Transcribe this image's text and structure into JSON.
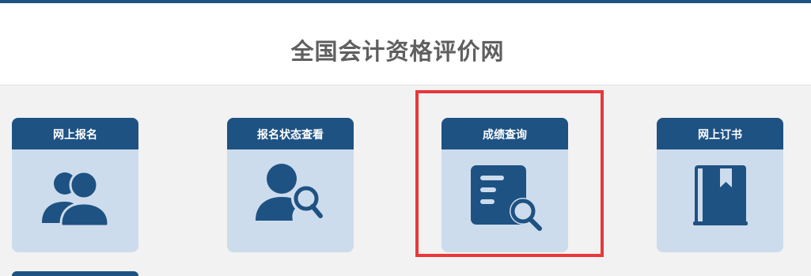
{
  "header": {
    "title": "全国会计资格评价网"
  },
  "cards": [
    {
      "label": "网上报名",
      "icon": "users-icon"
    },
    {
      "label": "报名状态查看",
      "icon": "user-search-icon"
    },
    {
      "label": "成绩查询",
      "icon": "document-search-icon"
    },
    {
      "label": "网上订书",
      "icon": "book-bookmark-icon"
    }
  ],
  "colors": {
    "primary": "#1e5283",
    "card_bg": "#cddcec",
    "highlight": "#e8383b",
    "title": "#5f5f5f"
  }
}
